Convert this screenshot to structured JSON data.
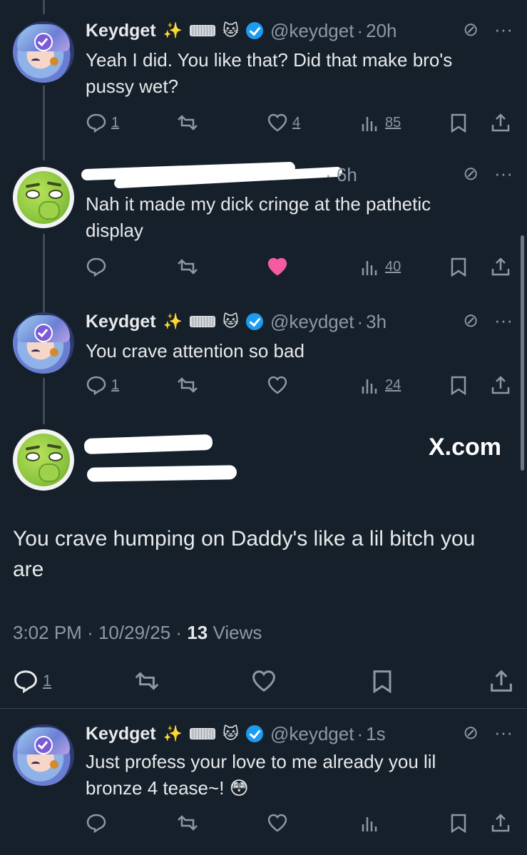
{
  "colors": {
    "background": "#15202b",
    "text": "#e7e9ea",
    "muted": "#8b98a5",
    "like_active": "#f91880",
    "verified": "#1d9bf0"
  },
  "tweets": [
    {
      "name": "Keydget",
      "handle": "@keydget",
      "time": "20h",
      "text": "Yeah I did. You like that? Did that make bro's pussy wet?",
      "replies": "1",
      "likes": "4",
      "views": "85"
    },
    {
      "name": "",
      "handle": "",
      "time": "6h",
      "text": "Nah it made my dick cringe at the pathetic display",
      "replies": "",
      "likes": "",
      "views": "40",
      "liked": true
    },
    {
      "name": "Keydget",
      "handle": "@keydget",
      "time": "3h",
      "text": "You crave attention so bad",
      "replies": "1",
      "likes": "",
      "views": "24"
    }
  ],
  "focused": {
    "text": "You crave humping on Daddy's like a lil bitch you are",
    "time": "3:02 PM",
    "date": "10/29/25",
    "views_count": "13",
    "views_label": "Views",
    "replies": "1",
    "watermark": "X.com"
  },
  "reply": {
    "name": "Keydget",
    "handle": "@keydget",
    "time": "1s",
    "text": "Just profess your love to me already you  lil bronze 4 tease~! 😳"
  },
  "glyphs": {
    "sparkles": "✨",
    "cat": "🐱",
    "dot": "·",
    "grok": "⊘",
    "more": "···"
  }
}
